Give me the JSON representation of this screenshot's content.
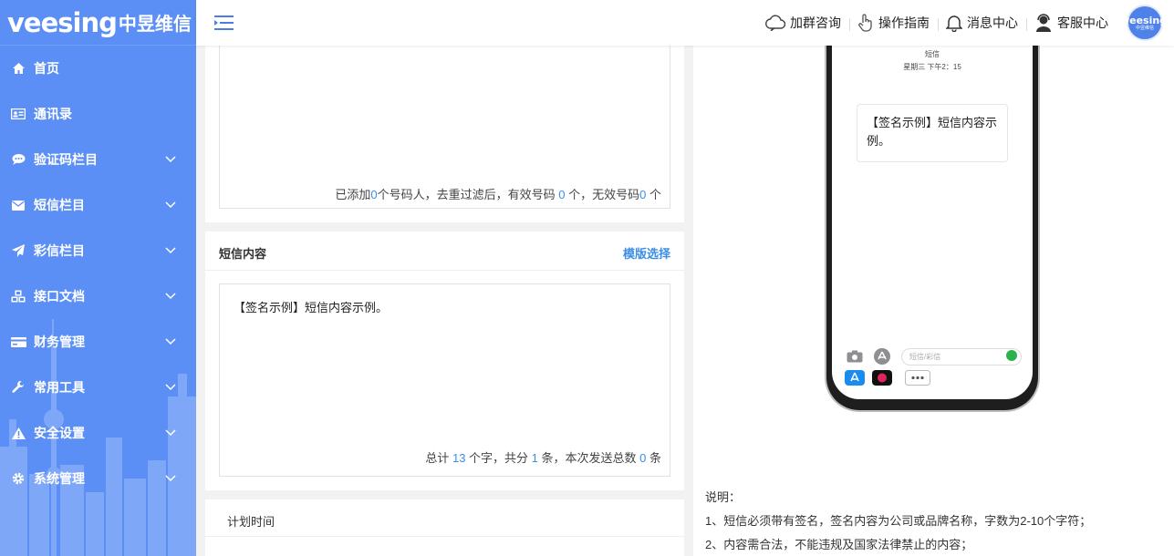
{
  "brand": {
    "logo_en": "veesing",
    "logo_cn": "中昱维信",
    "avatar_en": "veesing",
    "avatar_cn": "中昱维信"
  },
  "header": {
    "nav": [
      {
        "label": "加群咨询",
        "icon": "cloud-chat-icon"
      },
      {
        "label": "操作指南",
        "icon": "hand-pointer-icon"
      },
      {
        "label": "消息中心",
        "icon": "bell-icon"
      },
      {
        "label": "客服中心",
        "icon": "support-agent-icon"
      }
    ]
  },
  "sidebar": {
    "items": [
      {
        "label": "首页",
        "icon": "home-icon",
        "expandable": false
      },
      {
        "label": "通讯录",
        "icon": "address-book-icon",
        "expandable": false
      },
      {
        "label": "验证码栏目",
        "icon": "chat-bubble-icon",
        "expandable": true
      },
      {
        "label": "短信栏目",
        "icon": "envelope-icon",
        "expandable": true
      },
      {
        "label": "彩信栏目",
        "icon": "paper-plane-icon",
        "expandable": true
      },
      {
        "label": "接口文档",
        "icon": "cubes-icon",
        "expandable": true
      },
      {
        "label": "财务管理",
        "icon": "credit-card-icon",
        "expandable": true
      },
      {
        "label": "常用工具",
        "icon": "wrench-icon",
        "expandable": true
      },
      {
        "label": "安全设置",
        "icon": "warning-icon",
        "expandable": true
      },
      {
        "label": "系统管理",
        "icon": "gear-icon",
        "expandable": true
      }
    ]
  },
  "recipients": {
    "t1": "已添加",
    "added": "0",
    "t2": "个号码人，去重过滤后，有效号码 ",
    "valid": "0",
    "t3": " 个，无效号码",
    "invalid": "0",
    "t4": " 个"
  },
  "sms": {
    "title": "短信内容",
    "template_link": "模版选择",
    "content": "【签名示例】短信内容示例。",
    "t1": "总计 ",
    "chars": "13",
    "t2": " 个字，共分 ",
    "parts": "1",
    "t3": " 条，本次发送总数 ",
    "total": "0",
    "t4": " 条"
  },
  "schedule": {
    "title": "计划时间"
  },
  "preview": {
    "screen_title": "短信",
    "screen_time": "星期三 下午2：15",
    "bubble": "【签名示例】短信内容示例。",
    "input_placeholder": "短信/彩信"
  },
  "notes": {
    "heading": "说明：",
    "lines": [
      "1、短信必须带有签名，签名内容为公司或品牌名称，字数为2-10个字符；",
      "2、内容需合法，不能违规及国家法律禁止的内容；"
    ]
  },
  "colors": {
    "sidebar": "#5b8ff5",
    "accent": "#3a8ee6",
    "avatar": "#4f82e8"
  }
}
